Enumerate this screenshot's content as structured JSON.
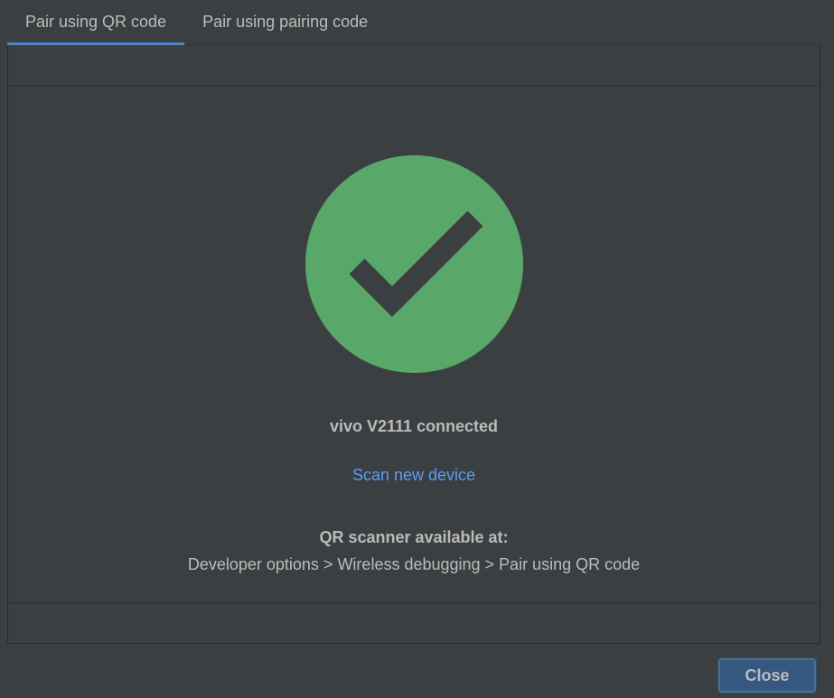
{
  "tabs": [
    {
      "label": "Pair using QR code",
      "selected": true
    },
    {
      "label": "Pair using pairing code",
      "selected": false
    }
  ],
  "status": {
    "icon": "check-circle-icon",
    "icon_color": "#59a869",
    "device_message": "vivo V2111 connected"
  },
  "actions": {
    "scan_new_device": "Scan new device"
  },
  "scanner_info": {
    "title": "QR scanner available at:",
    "path": "Developer options > Wireless debugging > Pair using QR code"
  },
  "footer": {
    "close_label": "Close"
  },
  "colors": {
    "background": "#3c3f41",
    "tab_underline": "#4a88c7",
    "link": "#589df6",
    "button": "#365880"
  }
}
